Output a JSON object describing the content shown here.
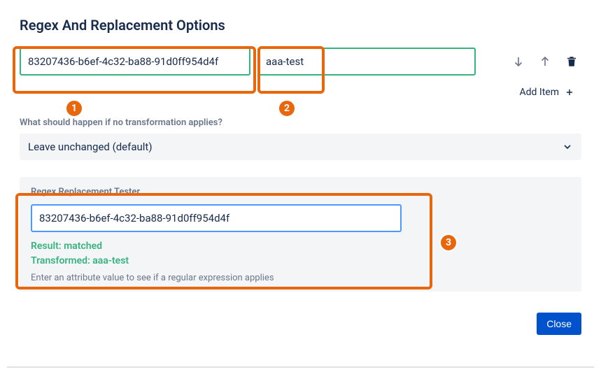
{
  "title": "Regex And Replacement Options",
  "row": {
    "regex_value": "83207436-b6ef-4c32-ba88-91d0ff954d4f",
    "replacement_value": "aaa-test"
  },
  "add_item_label": "Add Item",
  "no_transform": {
    "label": "What should happen if no transformation applies?",
    "value": "Leave unchanged (default)"
  },
  "tester": {
    "label": "Regex Replacement Tester",
    "input_value": "83207436-b6ef-4c32-ba88-91d0ff954d4f",
    "result_line": "Result: matched",
    "transformed_line": "Transformed: aaa-test",
    "hint": "Enter an attribute value to see if a regular expression applies"
  },
  "close_label": "Close",
  "annotations": {
    "badge1": "1",
    "badge2": "2",
    "badge3": "3"
  }
}
